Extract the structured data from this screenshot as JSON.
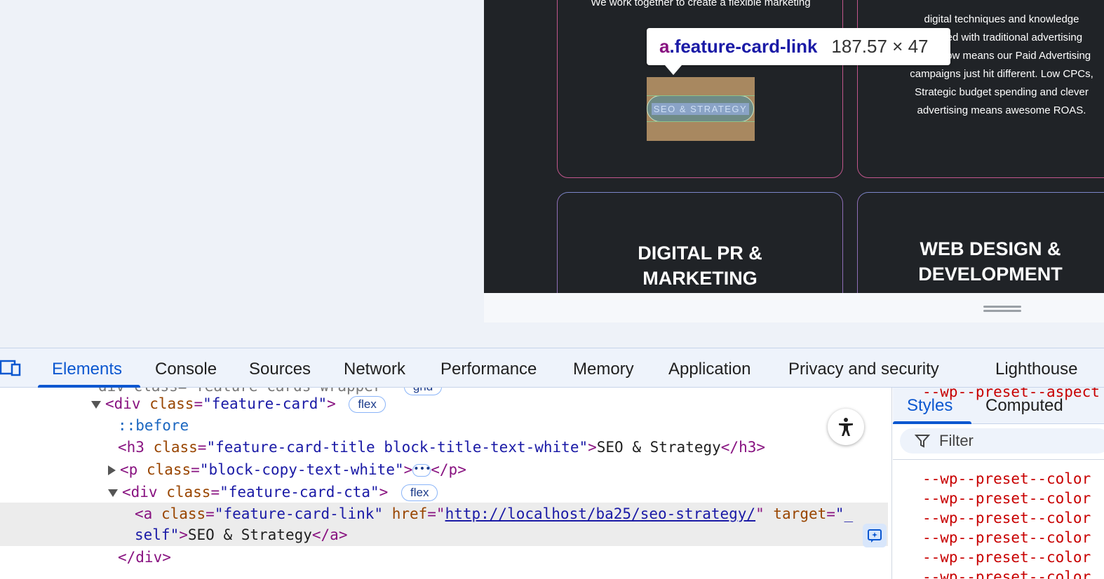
{
  "preview": {
    "card1_copy": "We work together to create a flexible marketing",
    "card2_copy_lines": [
      "digital techniques and knowledge",
      "blended with traditional advertising",
      "know-how means our Paid Advertising",
      "campaigns just hit different. Low CPCs,",
      "Strategic budget spending and clever",
      "advertising means awesome ROAS."
    ],
    "card3_title_lines": [
      "DIGITAL PR &",
      "MARKETING"
    ],
    "card4_title_lines": [
      "WEB DESIGN &",
      "DEVELOPMENT"
    ],
    "cta_label": "SEO & STRATEGY",
    "tooltip": {
      "tag": "a",
      "class": ".feature-card-link",
      "dimensions": "187.57 × 47"
    }
  },
  "devtools": {
    "tabs": [
      "Elements",
      "Console",
      "Sources",
      "Network",
      "Performance",
      "Memory",
      "Application",
      "Privacy and security",
      "Lighthouse"
    ],
    "active_tab": "Elements",
    "dom": {
      "line0": "div class=\"feature-cards-wrapper\"",
      "line0_badge": "grid",
      "line1_tag_open": "<div",
      "line1_attr": "class",
      "line1_val": "\"feature-card\"",
      "line1_badge": "flex",
      "line2_pseudo": "::before",
      "line3_attr": "class",
      "line3_val": "\"feature-card-title block-title-text-white\"",
      "line3_text": "SEO & Strategy",
      "line4_attr": "class",
      "line4_val": "\"block-copy-text-white\"",
      "line5_attr": "class",
      "line5_val": "\"feature-card-cta\"",
      "line5_badge": "flex",
      "line6_attr1": "class",
      "line6_val1": "\"feature-card-link\"",
      "line6_attr2": "href",
      "line6_href": "http://localhost/ba25/seo-strategy/",
      "line6_attr3": "target",
      "line6_val3_start": "\"_",
      "line7_val3_end": "self\"",
      "line7_text": "SEO & Strategy",
      "line8_close": "</div>"
    },
    "styles_tabs": [
      "Styles",
      "Computed"
    ],
    "filter_placeholder": "Filter",
    "style_props": [
      "--wp--preset--aspect",
      "--wp--preset--color",
      "--wp--preset--color",
      "--wp--preset--color",
      "--wp--preset--color",
      "--wp--preset--color",
      "--wp--preset--color"
    ]
  },
  "colors": {
    "accent": "#0b57d0",
    "site_bg": "#202327",
    "card_border": "#c2568c"
  }
}
